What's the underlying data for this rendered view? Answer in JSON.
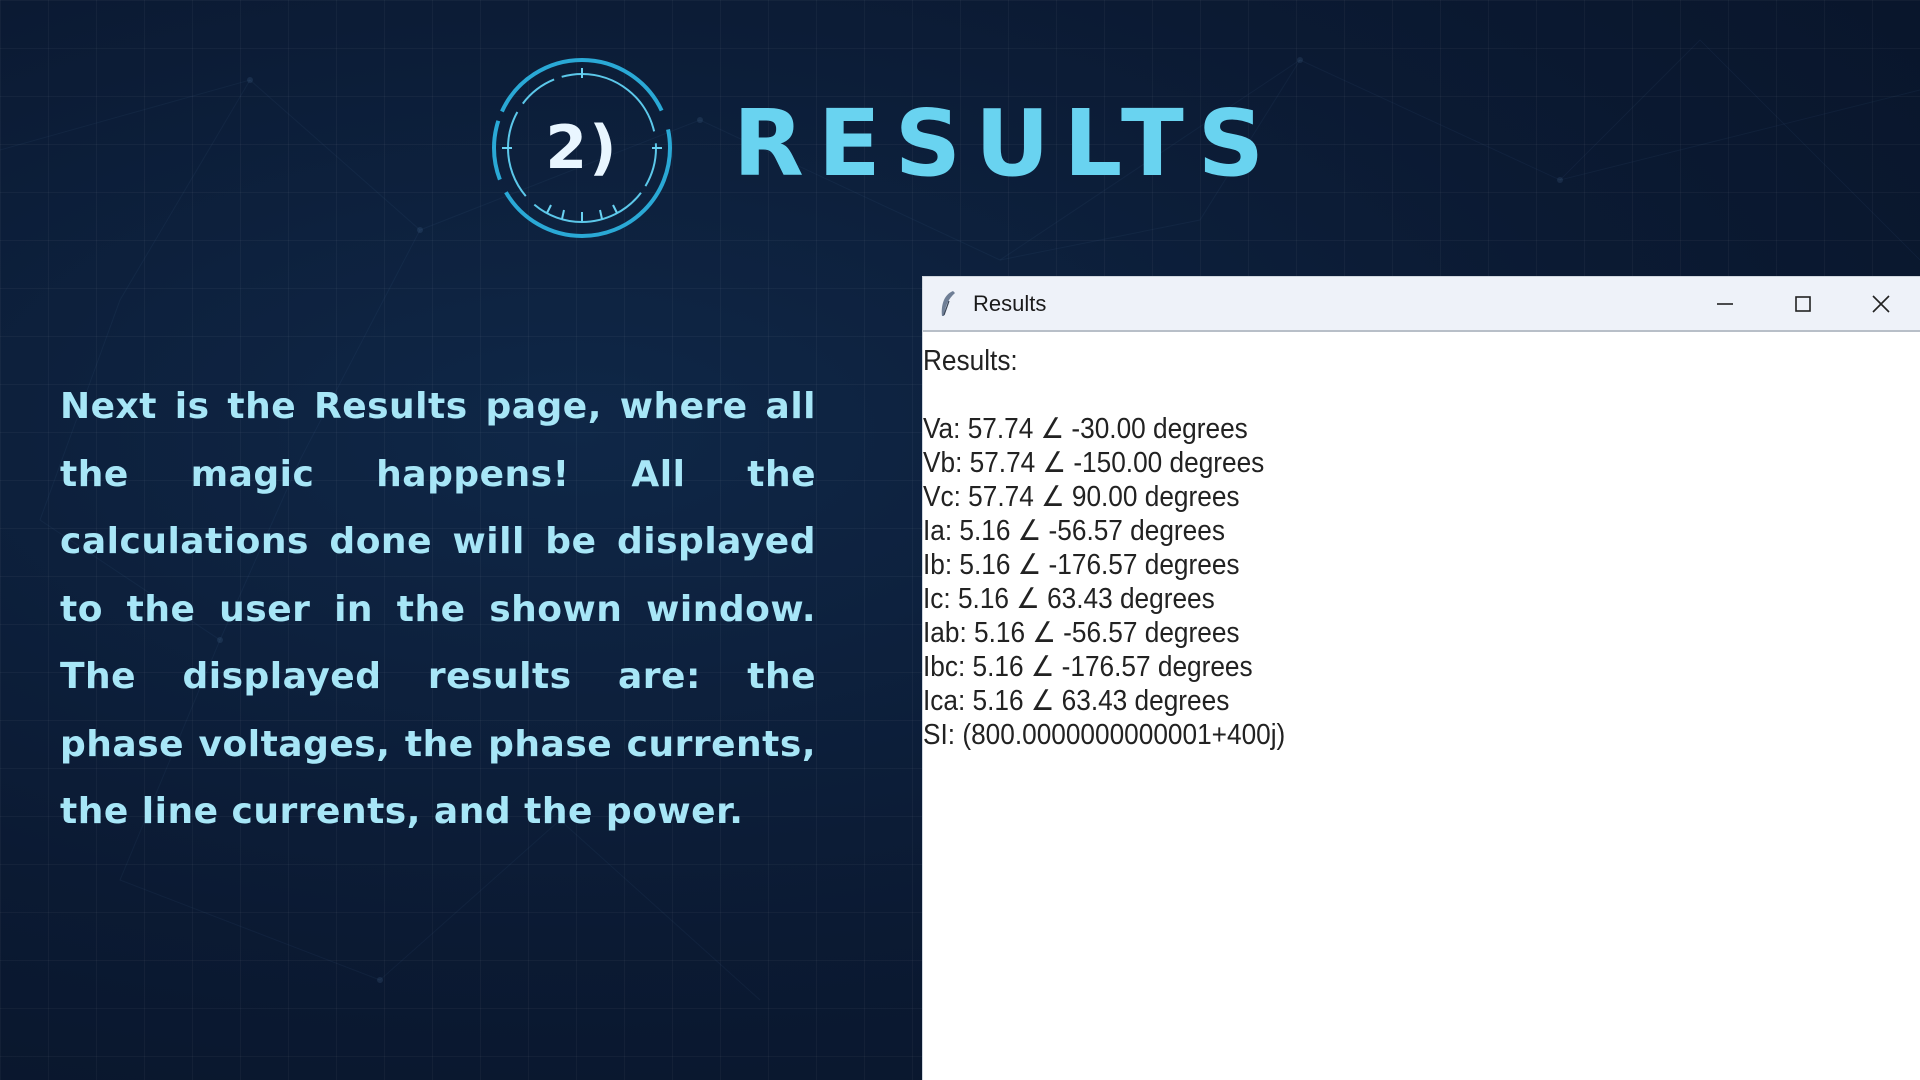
{
  "slide": {
    "badge": "2)",
    "title": "RESULTS",
    "description": "Next is the Results page, where all the magic happens! All the calculations done will be displayed to the user in the shown window. The displayed results are: the phase voltages, the phase currents, the line currents, and the power."
  },
  "window": {
    "title": "Results",
    "icon": "feather-icon",
    "controls": [
      "minimize-icon",
      "maximize-icon",
      "close-icon"
    ],
    "heading": "Results:",
    "lines": [
      "Va: 57.74 ∠ -30.00 degrees",
      "Vb: 57.74 ∠ -150.00 degrees",
      "Vc: 57.74 ∠ 90.00 degrees",
      "Ia: 5.16 ∠ -56.57 degrees",
      "Ib: 5.16 ∠ -176.57 degrees",
      "Ic: 5.16 ∠ 63.43 degrees",
      "Iab: 5.16 ∠ -56.57 degrees",
      "Ibc: 5.16 ∠ -176.57 degrees",
      "Ica: 5.16 ∠ 63.43 degrees",
      "SI: (800.0000000000001+400j)"
    ]
  },
  "colors": {
    "background": "#0b1a33",
    "accent": "#69d3f0",
    "text": "#a7e6f7"
  }
}
